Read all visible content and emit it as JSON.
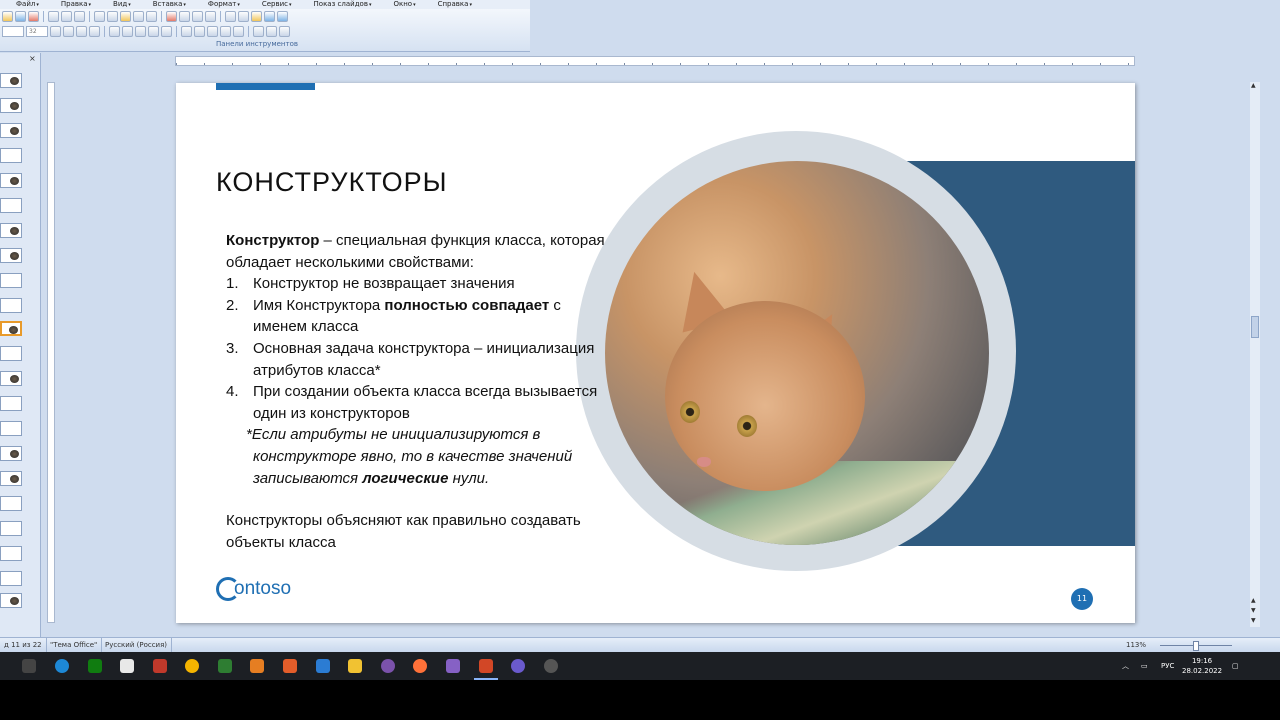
{
  "menu": [
    "Файл",
    "Правка",
    "Вид",
    "Вставка",
    "Формат",
    "Сервис",
    "Показ слайдов",
    "Окно",
    "Справка"
  ],
  "toolbar": {
    "font_size": "32",
    "panel_label": "Панели инструментов"
  },
  "slide": {
    "title": "КОНСТРУКТОРЫ",
    "intro_bold": "Конструктор",
    "intro_rest": " – специальная функция класса, которая обладает несколькими свойствами:",
    "items": [
      {
        "num": "1.",
        "text": "Конструктор не возвращает значения"
      },
      {
        "num": "2.",
        "pre": "Имя Конструктора ",
        "bold": "полностью совпадает",
        "post": " с именем класса"
      },
      {
        "num": "3.",
        "text": "Основная задача конструктора – инициализация атрибутов класса*"
      },
      {
        "num": "4.",
        "text": "При создании объекта класса всегда вызывается один из конструкторов"
      }
    ],
    "note_pre": "*Если атрибуты не инициализируются в",
    "note_line2_pre": "конструкторе явно, то в качестве значений записываются ",
    "note_bold": "логические",
    "note_post": "  нули.",
    "conclusion": "Конструкторы объясняют как правильно создавать объекты класса",
    "logo_text": "ontoso",
    "page_number": "11"
  },
  "status": {
    "slide_counter": "д 11 из 22",
    "theme": "\"Тема Office\"",
    "language": "Русский (Россия)",
    "zoom": "113%"
  },
  "taskbar": {
    "lang": "РУС",
    "time": "19:16",
    "date": "28.02.2022"
  },
  "colors": {
    "accent": "#1f6fb3",
    "panel_blue": "#2f5a7f"
  }
}
